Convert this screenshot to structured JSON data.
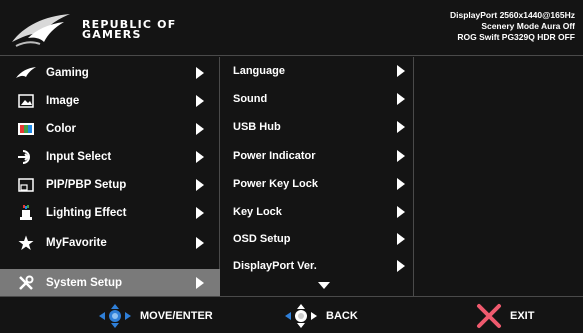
{
  "brand": {
    "line1": "REPUBLIC OF",
    "line2": "GAMERS"
  },
  "status": {
    "line1": "DisplayPort 2560x1440@165Hz",
    "line2": "Scenery Mode Aura Off",
    "line3": "ROG Swift PG329Q HDR OFF"
  },
  "main_menu": [
    {
      "label": "Gaming",
      "icon": "rog-eye-icon"
    },
    {
      "label": "Image",
      "icon": "image-icon"
    },
    {
      "label": "Color",
      "icon": "color-icon"
    },
    {
      "label": "Input Select",
      "icon": "input-select-icon"
    },
    {
      "label": "PIP/PBP Setup",
      "icon": "pip-icon"
    },
    {
      "label": "Lighting Effect",
      "icon": "lighting-icon"
    },
    {
      "label": "MyFavorite",
      "icon": "star-icon"
    },
    {
      "label": "System Setup",
      "icon": "wrench-icon",
      "selected": true
    }
  ],
  "sub_menu": [
    {
      "label": "Language"
    },
    {
      "label": "Sound"
    },
    {
      "label": "USB Hub"
    },
    {
      "label": "Power Indicator"
    },
    {
      "label": "Power Key Lock"
    },
    {
      "label": "Key Lock"
    },
    {
      "label": "OSD Setup"
    },
    {
      "label": "DisplayPort Ver."
    }
  ],
  "footer": {
    "move_label": "MOVE/ENTER",
    "back_label": "BACK",
    "exit_label": "EXIT"
  },
  "colors": {
    "accent_blue": "#2f7fd8",
    "exit_pink": "#ef5a6e",
    "selected_row": "#7a7a7a"
  }
}
